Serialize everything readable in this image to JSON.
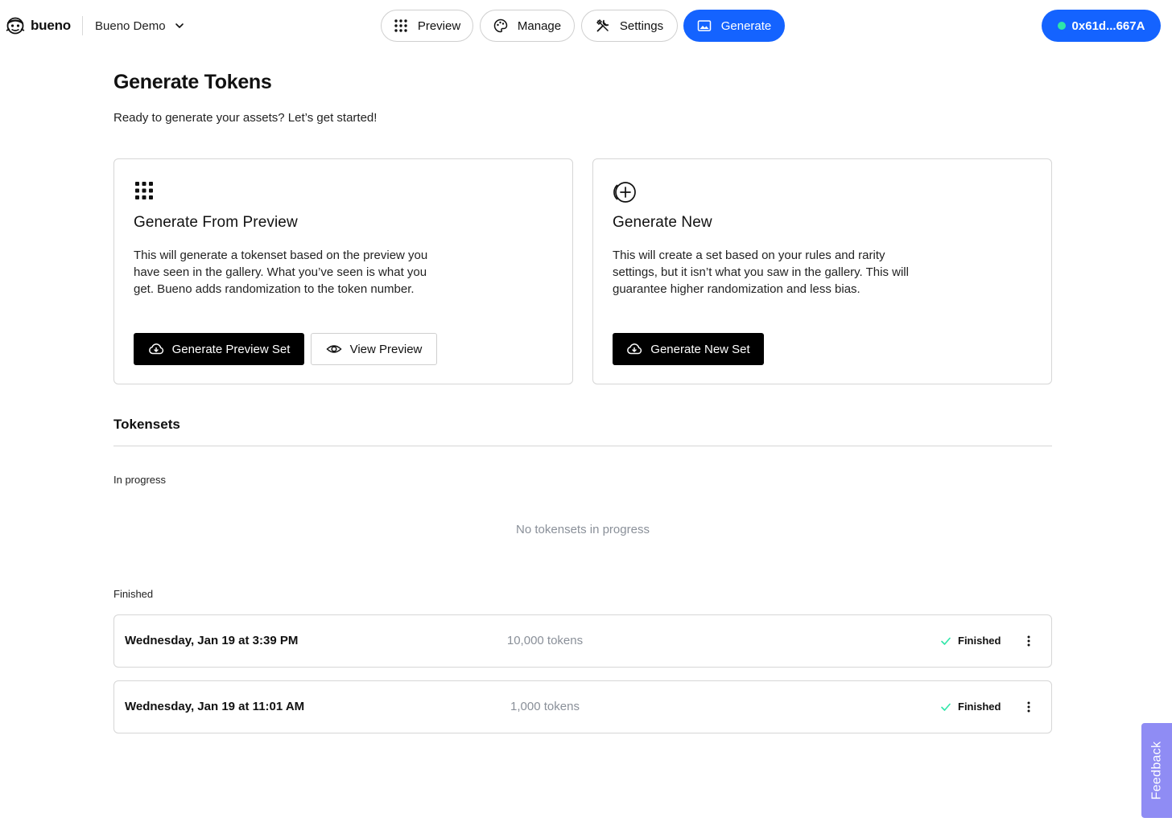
{
  "brand": {
    "name": "bueno"
  },
  "project": {
    "name": "Bueno Demo"
  },
  "nav": {
    "preview": "Preview",
    "manage": "Manage",
    "settings": "Settings",
    "generate": "Generate"
  },
  "wallet": {
    "address": "0x61d...667A",
    "status_color": "#2ee6a8"
  },
  "colors": {
    "accent": "#1463ff",
    "feedback": "#8f8cf4",
    "success": "#2ee6a8"
  },
  "header": {
    "title": "Generate Tokens",
    "subtitle": "Ready to generate your assets? Let’s get started!"
  },
  "cards": [
    {
      "icon": "grid-dots-icon",
      "title": "Generate From Preview",
      "description": "This will generate a tokenset based on the preview you have seen in the gallery. What you’ve seen is what you get. Bueno adds randomization to the token number.",
      "primary_button": "Generate Preview Set",
      "secondary_button": "View Preview"
    },
    {
      "icon": "add-circle-icon",
      "title": "Generate New",
      "description": "This will create a set based on your rules and rarity settings, but it isn’t what you saw in the gallery. This will guarantee higher randomization and less bias.",
      "primary_button": "Generate New Set"
    }
  ],
  "tokensets": {
    "title": "Tokensets",
    "in_progress_label": "In progress",
    "empty_message": "No tokensets in progress",
    "finished_label": "Finished",
    "finished": [
      {
        "date": "Wednesday, Jan 19 at 3:39 PM",
        "count": "10,000 tokens",
        "status": "Finished"
      },
      {
        "date": "Wednesday, Jan 19 at 11:01 AM",
        "count": "1,000 tokens",
        "status": "Finished"
      }
    ]
  },
  "feedback": {
    "label": "Feedback"
  }
}
